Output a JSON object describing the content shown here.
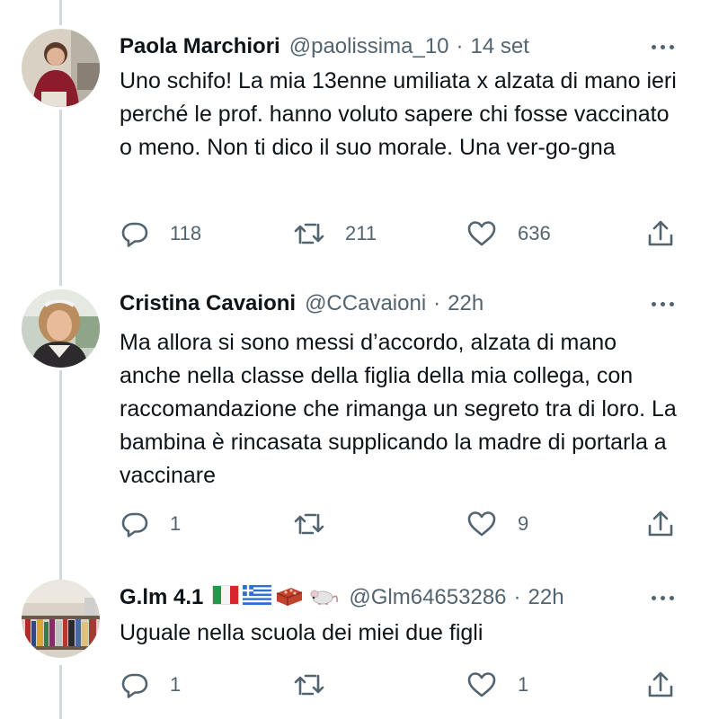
{
  "tweets": [
    {
      "name": "Paola Marchiori",
      "handle": "@paolissima_10",
      "separator": "·",
      "time": "14 set",
      "text": "Uno schifo! La mia 13enne umiliata x alzata di mano ieri perché le prof. hanno voluto sapere chi fosse vaccinato o meno. Non ti dico il suo morale. Una ver-go-gna",
      "replies": "118",
      "retweets": "211",
      "likes": "636"
    },
    {
      "name": "Cristina Cavaioni",
      "handle": "@CCavaioni",
      "separator": "·",
      "time": "22h",
      "text": "Ma allora si sono messi d’accordo, alzata di mano anche nella classe della figlia della mia collega, con raccomandazione che rimanga un segreto tra di loro. La bambina è rincasata supplicando la madre di portarla a vaccinare",
      "replies": "1",
      "retweets": "",
      "likes": "9"
    },
    {
      "name": "G.lm 4.1",
      "name_emojis": [
        "flag-italy-icon",
        "flag-greece-icon",
        "brick-icon",
        "mouse-icon"
      ],
      "handle": "@Glm64653286",
      "separator": "·",
      "time": "22h",
      "text": "Uguale nella scuola dei miei due figli",
      "replies": "1",
      "retweets": "",
      "likes": "1"
    }
  ],
  "colors": {
    "text": "#0f1419",
    "secondary": "#536471",
    "thread_line": "#cfd9de"
  },
  "icons": [
    "reply-icon",
    "retweet-icon",
    "like-icon",
    "share-icon",
    "more-options-icon"
  ]
}
